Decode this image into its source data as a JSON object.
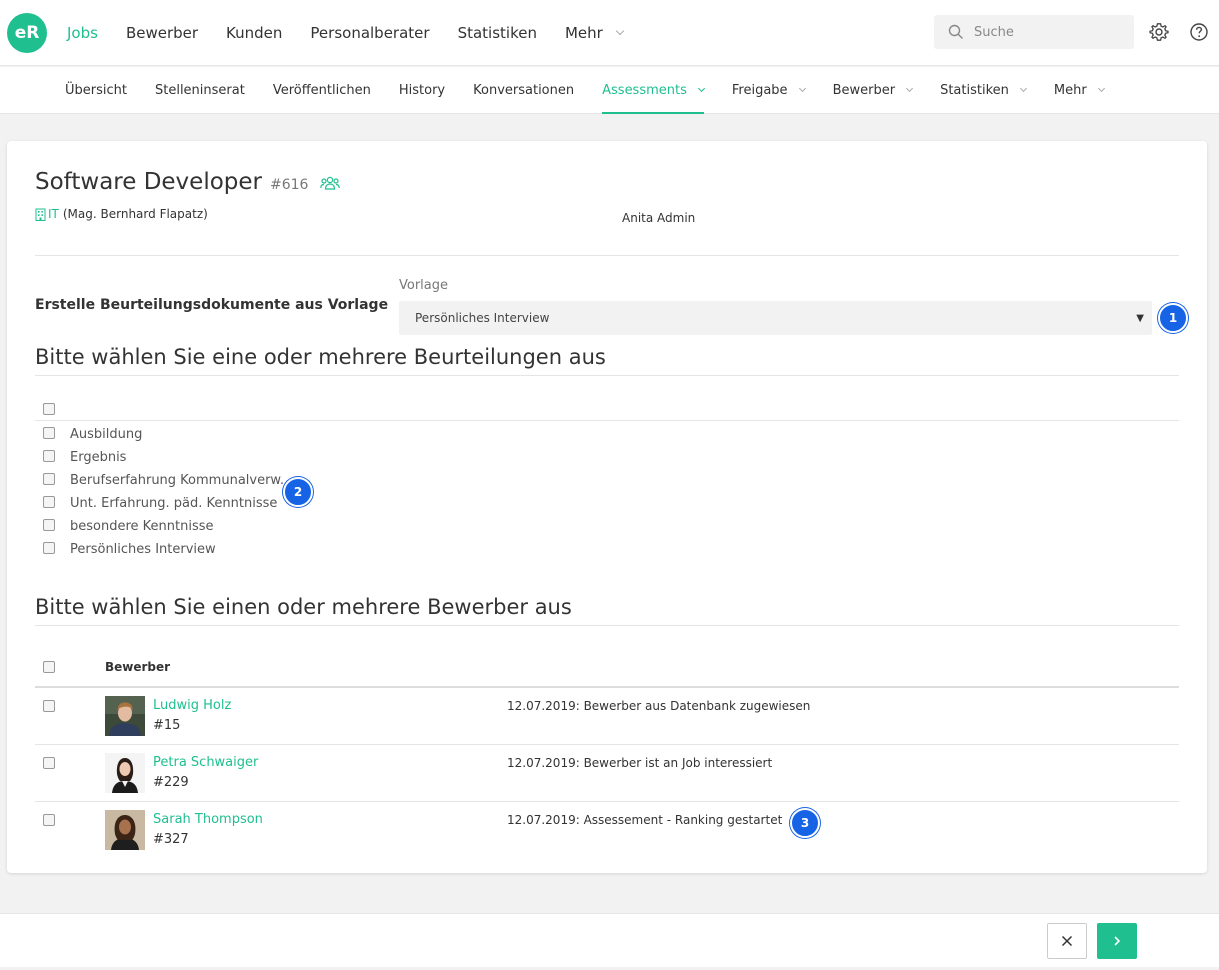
{
  "brand": {
    "logo_text": "eR",
    "accent": "#1fbf8f",
    "badge_color": "#1763e6"
  },
  "main_nav": [
    {
      "label": "Jobs",
      "active": true
    },
    {
      "label": "Bewerber"
    },
    {
      "label": "Kunden"
    },
    {
      "label": "Personalberater"
    },
    {
      "label": "Statistiken"
    },
    {
      "label": "Mehr",
      "dropdown": true
    }
  ],
  "search": {
    "placeholder": "Suche"
  },
  "sub_nav": [
    {
      "label": "Übersicht"
    },
    {
      "label": "Stelleninserat"
    },
    {
      "label": "Veröffentlichen"
    },
    {
      "label": "History"
    },
    {
      "label": "Konversationen"
    },
    {
      "label": "Assessments",
      "active": true,
      "dropdown": true
    },
    {
      "label": "Freigabe",
      "dropdown": true
    },
    {
      "label": "Bewerber",
      "dropdown": true
    },
    {
      "label": "Statistiken",
      "dropdown": true
    },
    {
      "label": "Mehr",
      "dropdown": true
    }
  ],
  "job": {
    "title": "Software Developer",
    "id": "#616",
    "department": "IT",
    "department_contact": "(Mag. Bernhard Flapatz)",
    "owner": "Anita Admin"
  },
  "template_section": {
    "label": "Erstelle Beurteilungsdokumente aus Vorlage",
    "field_label": "Vorlage",
    "selected": "Persönliches Interview",
    "badge": "1"
  },
  "assessments": {
    "title": "Bitte wählen Sie eine oder mehrere Beurteilungen aus",
    "badge": "2",
    "items": [
      "Ausbildung",
      "Ergebnis",
      "Berufserfahrung Kommunalverw.",
      "Unt. Erfahrung. päd. Kenntnisse",
      "besondere Kenntnisse",
      "Persönliches Interview"
    ]
  },
  "candidates": {
    "title": "Bitte wählen Sie einen oder mehrere Bewerber aus",
    "column_header": "Bewerber",
    "badge": "3",
    "rows": [
      {
        "name": "Ludwig Holz",
        "id": "#15",
        "status": "12.07.2019: Bewerber aus Datenbank zugewiesen"
      },
      {
        "name": "Petra Schwaiger",
        "id": "#229",
        "status": "12.07.2019: Bewerber ist an Job interessiert"
      },
      {
        "name": "Sarah Thompson",
        "id": "#327",
        "status": "12.07.2019: Assessement - Ranking gestartet"
      }
    ]
  }
}
